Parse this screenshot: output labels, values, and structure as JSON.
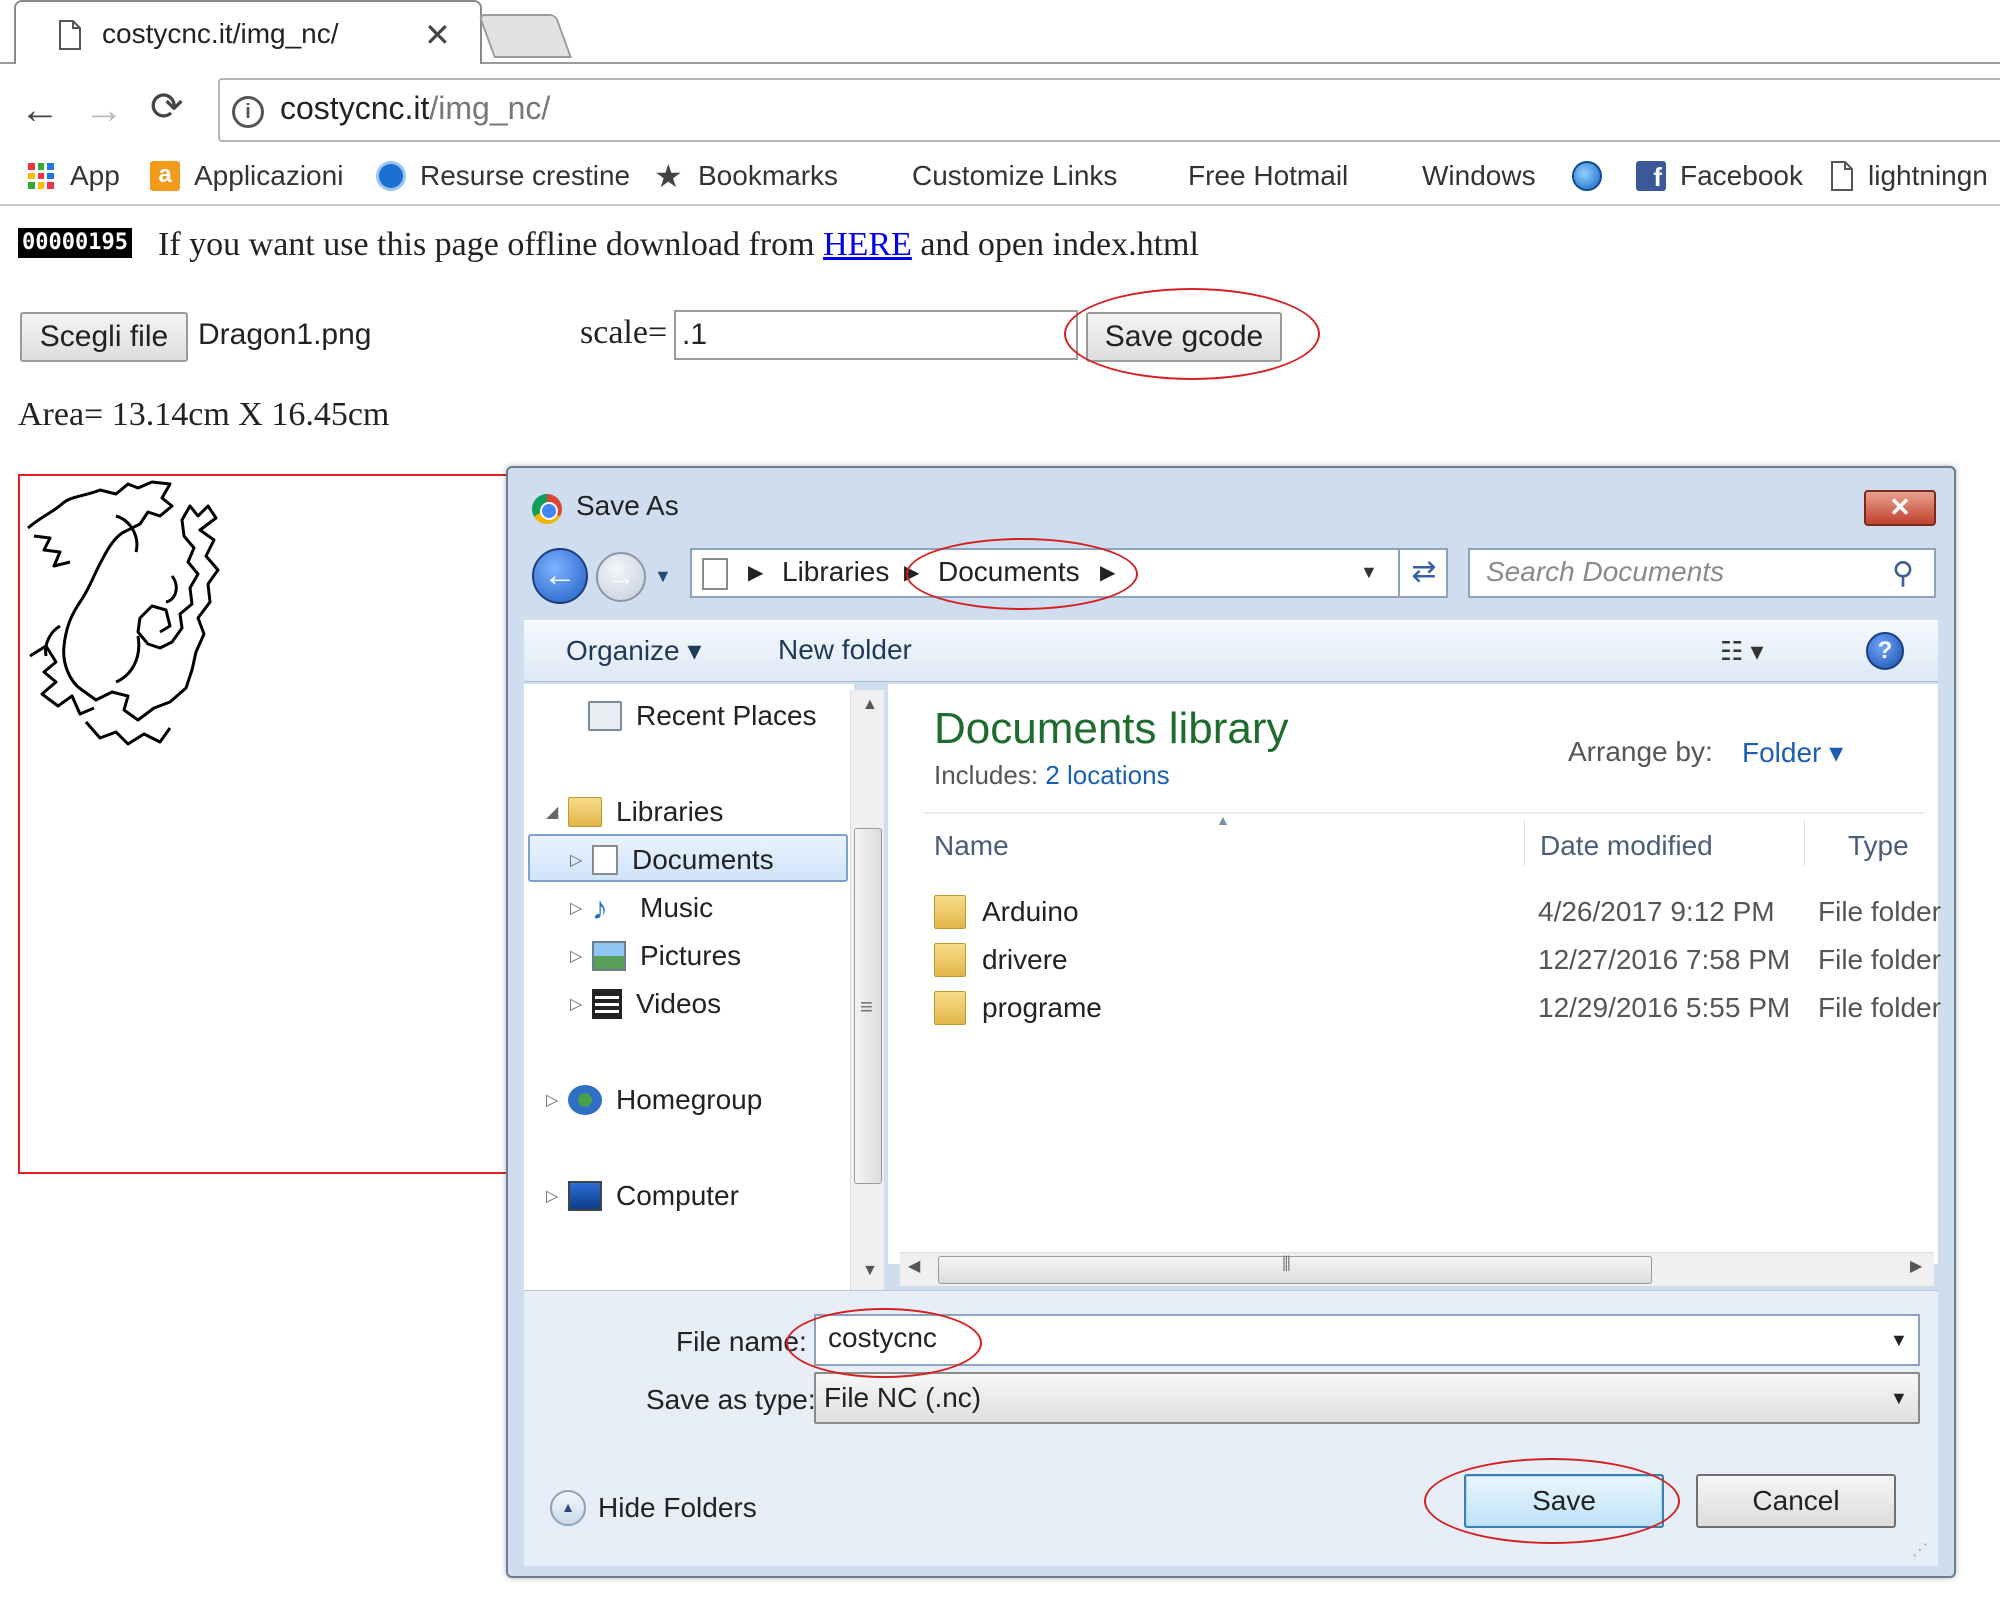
{
  "browser": {
    "tab_title": "costycnc.it/img_nc/",
    "tab_close": "✕",
    "url_host": "costycnc.it",
    "url_path": "/img_nc/",
    "nav_back": "←",
    "nav_forward": "→",
    "nav_reload": "⟳",
    "info_icon": "i"
  },
  "bookmarks": [
    {
      "label": "App",
      "icon": "apps-grid-icon"
    },
    {
      "label": "Applicazioni",
      "icon": "amazon-icon"
    },
    {
      "label": "Resurse crestine",
      "icon": "resurse-icon"
    },
    {
      "label": "Bookmarks",
      "icon": "star-icon"
    },
    {
      "label": "Customize Links",
      "icon": "windows-logo-icon"
    },
    {
      "label": "Free Hotmail",
      "icon": "windows-logo-icon"
    },
    {
      "label": "Windows",
      "icon": "windows-logo-icon"
    },
    {
      "label": "",
      "icon": "globe-icon"
    },
    {
      "label": "Facebook",
      "icon": "facebook-icon"
    },
    {
      "label": "lightningn",
      "icon": "page-icon"
    }
  ],
  "page": {
    "counter": "00000195",
    "offline_before": "If you want use this page offline download from ",
    "offline_link": "HERE",
    "offline_after": " and open index.html",
    "choose_file_label": "Scegli file",
    "file_name": "Dragon1.png",
    "scale_label": "scale=",
    "scale_value": ".1",
    "save_gcode_label": "Save gcode",
    "area_text": "Area= 13.14cm X 16.45cm"
  },
  "dialog": {
    "title": "Save As",
    "close_label": "✕",
    "breadcrumb": [
      "Libraries",
      "Documents"
    ],
    "search_placeholder": "Search Documents",
    "organize_label": "Organize ▾",
    "new_folder_label": "New folder",
    "nav_tree": [
      {
        "label": "Recent Places",
        "icon": "recent-places-icon"
      },
      {
        "label": "Libraries",
        "icon": "libraries-icon"
      },
      {
        "label": "Documents",
        "icon": "documents-icon"
      },
      {
        "label": "Music",
        "icon": "music-icon"
      },
      {
        "label": "Pictures",
        "icon": "pictures-icon"
      },
      {
        "label": "Videos",
        "icon": "videos-icon"
      },
      {
        "label": "Homegroup",
        "icon": "homegroup-icon"
      },
      {
        "label": "Computer",
        "icon": "computer-icon"
      }
    ],
    "library_title": "Documents library",
    "includes_label": "Includes: ",
    "includes_link": "2 locations",
    "arrange_label": "Arrange by:",
    "arrange_value": "Folder ▾",
    "columns": [
      "Name",
      "Date modified",
      "Type"
    ],
    "files": [
      {
        "name": "Arduino",
        "date": "4/26/2017 9:12 PM",
        "type": "File folder"
      },
      {
        "name": "drivere",
        "date": "12/27/2016 7:58 PM",
        "type": "File folder"
      },
      {
        "name": "programe",
        "date": "12/29/2016 5:55 PM",
        "type": "File folder"
      }
    ],
    "file_name_label": "File name:",
    "file_name_value": "costycnc",
    "save_type_label": "Save as type:",
    "save_type_value": "File NC (.nc)",
    "hide_folders_label": "Hide Folders",
    "save_label": "Save",
    "cancel_label": "Cancel"
  },
  "colors": {
    "annotation": "#d42020",
    "library_title": "#1e6b2e",
    "link": "#1a5fb4",
    "canvas_border": "#e02020"
  }
}
